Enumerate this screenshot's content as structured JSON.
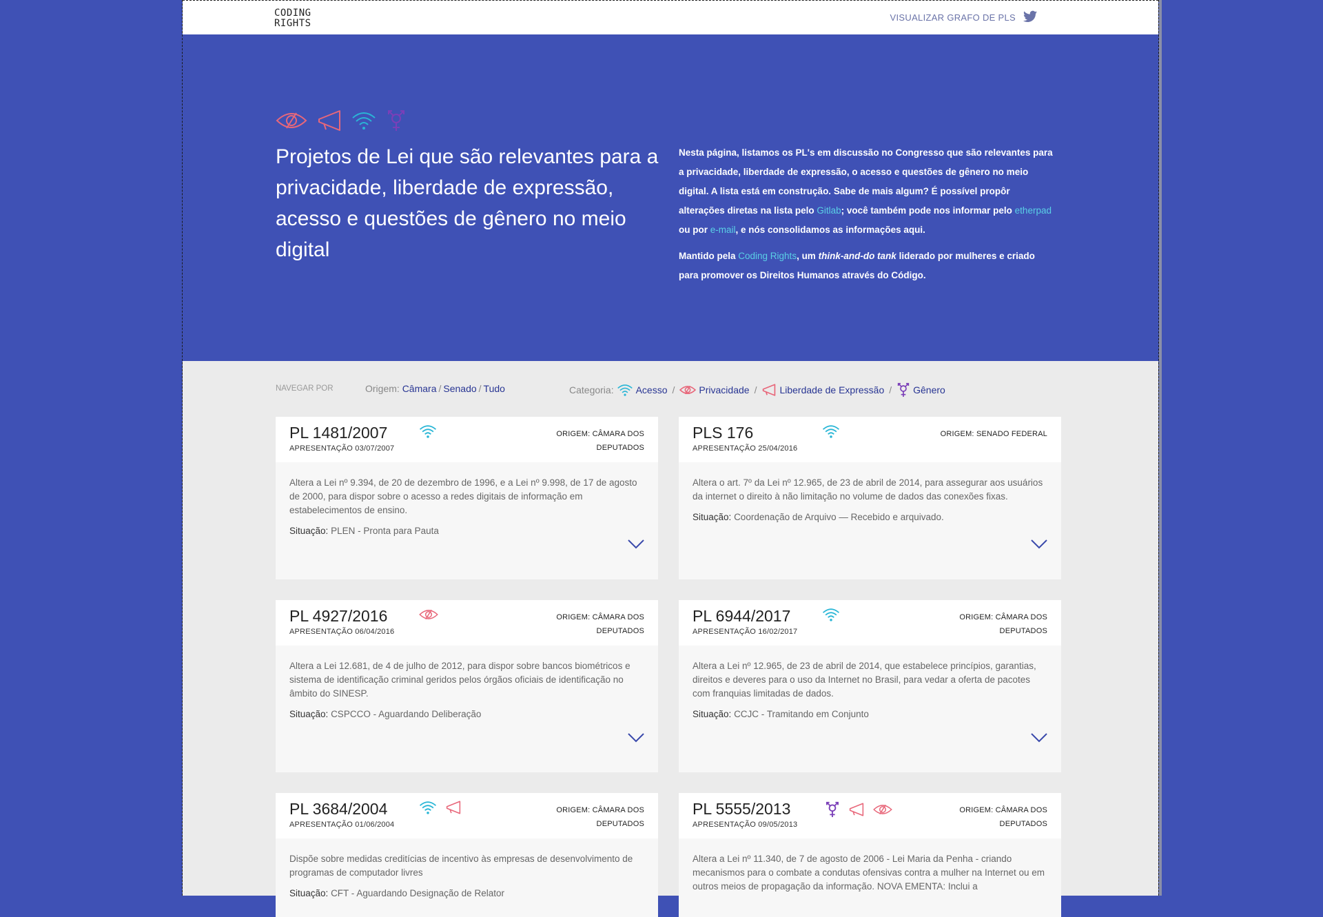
{
  "header": {
    "logo_line1": "CODING",
    "logo_line2": "RIGHTS",
    "graph_link": "VISUALIZAR GRAFO DE PLS"
  },
  "hero": {
    "title": "Projetos de Lei que são relevantes para a privacidade, liberdade de expressão, acesso e questões de gênero no meio digital",
    "desc_part1": "Nesta página, listamos os PL's em discussão no Congresso que são relevantes para a privacidade, liberdade de expressão, o acesso e questões de gênero no meio digital. A lista está em construção. Sabe de mais algum? É possível propôr alterações diretas na lista pelo ",
    "link_gitlab": "Gitlab",
    "desc_part2": "; você também pode nos informar pelo ",
    "link_etherpad": "etherpad",
    "desc_part3": " ou por ",
    "link_email": "e-mail",
    "desc_part4": ", e nós consolidamos as informações aqui.",
    "maintained_part1": "Mantido pela ",
    "link_coding_rights": "Coding Rights",
    "maintained_part2": ", um ",
    "maintained_italic": "think-and-do tank",
    "maintained_part3": " liderado por mulheres e criado para promover os Direitos Humanos através do Código."
  },
  "filters": {
    "nav_label": "NAVEGAR POR",
    "origin_label": "Origem:",
    "origin_options": [
      "Câmara",
      "Senado",
      "Tudo"
    ],
    "category_label": "Categoria:",
    "category_options": [
      "Acesso",
      "Privacidade",
      "Liberdade de Expressão",
      "Gênero"
    ]
  },
  "labels": {
    "status": "Situação:"
  },
  "colors": {
    "access": "#29b6d6",
    "privacy": "#e8677a",
    "expression": "#e8677a",
    "gender": "#7b3fb8",
    "link": "#283593"
  },
  "cards": [
    {
      "number": "PL 1481/2007",
      "date": "APRESENTAÇÃO 03/07/2007",
      "origin": "ORIGEM: CÂMARA DOS DEPUTADOS",
      "icons": [
        "wifi-icon"
      ],
      "summary": "Altera a Lei nº 9.394, de 20 de dezembro de 1996, e a Lei nº 9.998, de 17 de agosto de 2000, para dispor sobre o acesso a redes digitais de informação em estabelecimentos de ensino.",
      "status": "PLEN - Pronta para Pauta"
    },
    {
      "number": "PLS 176",
      "date": "APRESENTAÇÃO 25/04/2016",
      "origin": "ORIGEM: SENADO FEDERAL",
      "icons": [
        "wifi-icon"
      ],
      "summary": "Altera o art. 7º da Lei nº 12.965, de 23 de abril de 2014, para assegurar aos usuários da internet o direito à não limitação no volume de dados das conexões fixas.",
      "status": "Coordenação de Arquivo — Recebido e arquivado."
    },
    {
      "number": "PL 4927/2016",
      "date": "APRESENTAÇÃO 06/04/2016",
      "origin": "ORIGEM: CÂMARA DOS DEPUTADOS",
      "icons": [
        "eye-slash-icon"
      ],
      "summary": "Altera a Lei 12.681, de 4 de julho de 2012, para dispor sobre bancos biométricos e sistema de identificação criminal geridos pelos órgãos oficiais de identificação no âmbito do SINESP.",
      "status": "CSPCCO - Aguardando Deliberação"
    },
    {
      "number": "PL 6944/2017",
      "date": "APRESENTAÇÃO 16/02/2017",
      "origin": "ORIGEM: CÂMARA DOS DEPUTADOS",
      "icons": [
        "wifi-icon"
      ],
      "summary": "Altera a Lei nº 12.965, de 23 de abril de 2014, que estabelece princípios, garantias, direitos e deveres para o uso da Internet no Brasil, para vedar a oferta de pacotes com franquias limitadas de dados.",
      "status": "CCJC - Tramitando em Conjunto"
    },
    {
      "number": "PL 3684/2004",
      "date": "APRESENTAÇÃO 01/06/2004",
      "origin": "ORIGEM: CÂMARA DOS DEPUTADOS",
      "icons": [
        "wifi-icon",
        "megaphone-icon"
      ],
      "summary": "Dispõe sobre medidas creditícias de incentivo às empresas de desenvolvimento de programas de computador livres",
      "status": "CFT - Aguardando Designação de Relator"
    },
    {
      "number": "PL 5555/2013",
      "date": "APRESENTAÇÃO 09/05/2013",
      "origin": "ORIGEM: CÂMARA DOS DEPUTADOS",
      "icons": [
        "gender-icon",
        "megaphone-icon",
        "eye-slash-icon"
      ],
      "summary": "Altera a Lei nº 11.340, de 7 de agosto de 2006 - Lei Maria da Penha - criando mecanismos para o combate a condutas ofensivas contra a mulher na Internet ou em outros meios de propagação da informação. NOVA EMENTA: Inclui a",
      "status": ""
    }
  ]
}
